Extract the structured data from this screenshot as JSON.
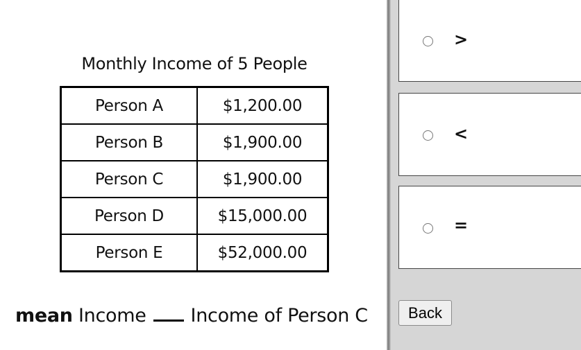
{
  "question": {
    "table_title": "Monthly Income of 5 People",
    "table": {
      "rows": [
        {
          "person": "Person A",
          "income": "$1,200.00"
        },
        {
          "person": "Person B",
          "income": "$1,900.00"
        },
        {
          "person": "Person C",
          "income": "$1,900.00"
        },
        {
          "person": "Person D",
          "income": "$15,000.00"
        },
        {
          "person": "Person E",
          "income": "$52,000.00"
        }
      ]
    },
    "prompt": {
      "bold_word": "mean",
      "left_text": "Income",
      "right_text": "Income of Person C"
    }
  },
  "answers": {
    "options": [
      {
        "symbol": ">",
        "selected": false
      },
      {
        "symbol": "<",
        "selected": false
      },
      {
        "symbol": "=",
        "selected": false
      }
    ],
    "back_label": "Back"
  }
}
